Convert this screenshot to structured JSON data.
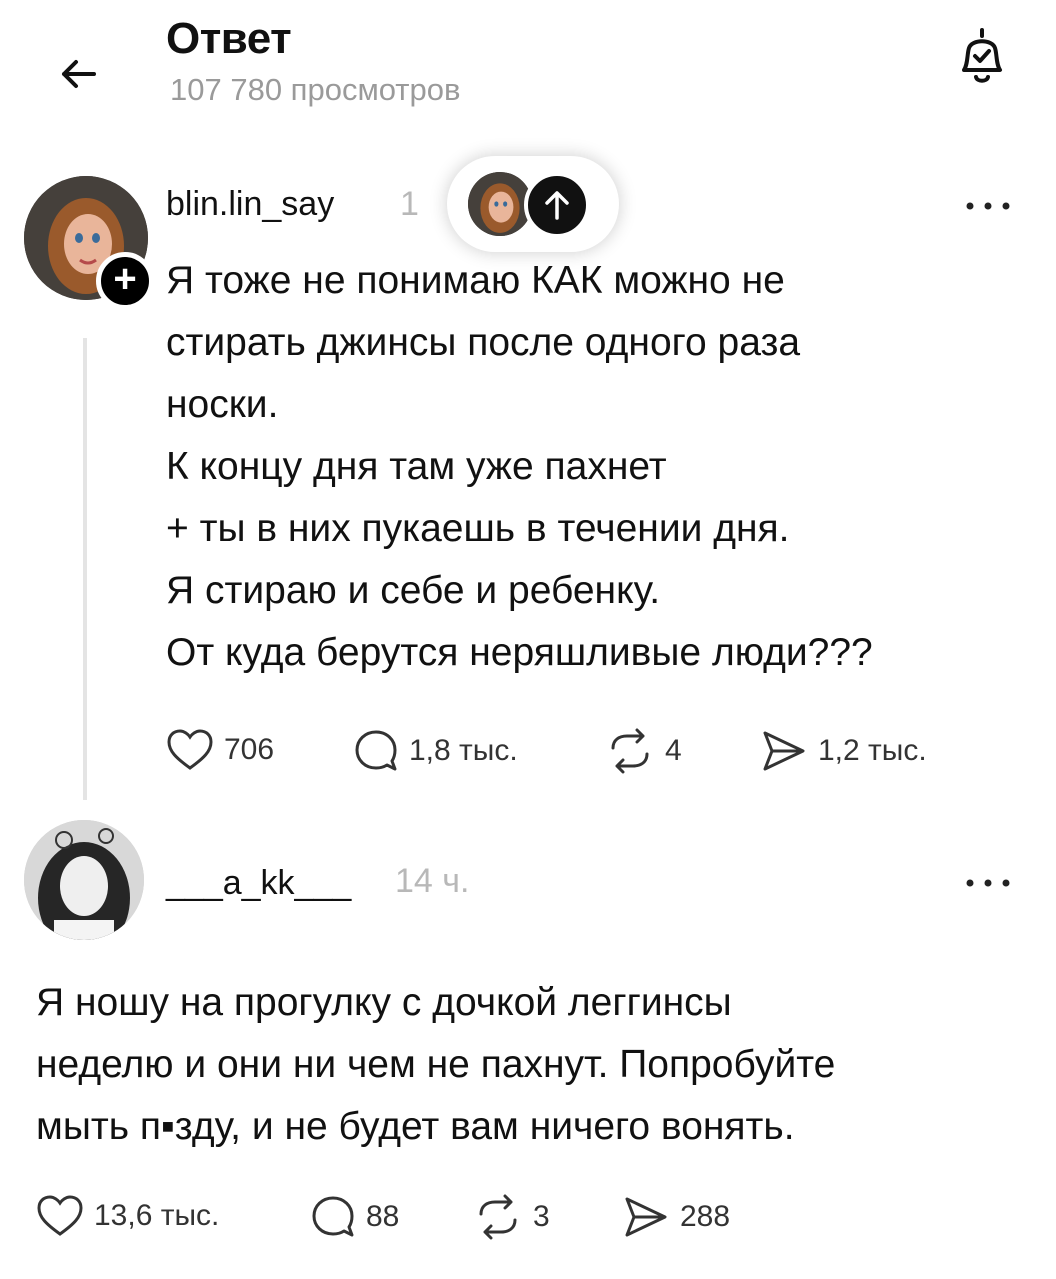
{
  "header": {
    "title": "Ответ",
    "views": "107 780 просмотров"
  },
  "post1": {
    "username": "blin.lin_say",
    "time": "1",
    "text_lines": [
      "Я тоже не понимаю КАК можно не",
      "стирать джинсы после одного раза",
      "носки.",
      "К концу дня там уже пахнет",
      "+ ты в них пукаешь в течении дня.",
      "Я стираю и себе и ребенку.",
      "От куда берутся неряшливые люди???"
    ],
    "likes": "706",
    "replies": "1,8 тыс.",
    "reposts": "4",
    "shares": "1,2 тыс."
  },
  "post2": {
    "username": "___a_kk___",
    "time": "14 ч.",
    "text_lines": [
      "Я ношу на прогулку с дочкой леггинсы",
      "неделю и они ни чем не пахнут. Попробуйте",
      "мыть п▪зду, и не будет вам ничего вонять."
    ],
    "likes": "13,6 тыс.",
    "replies": "88",
    "reposts": "3",
    "shares": "288"
  },
  "icons": {
    "back": "arrow-left-icon",
    "bell": "bell-check-icon",
    "like": "heart-icon",
    "reply": "comment-icon",
    "repost": "repost-icon",
    "share": "send-icon",
    "more": "more-dots-icon",
    "up": "arrow-up-icon"
  }
}
